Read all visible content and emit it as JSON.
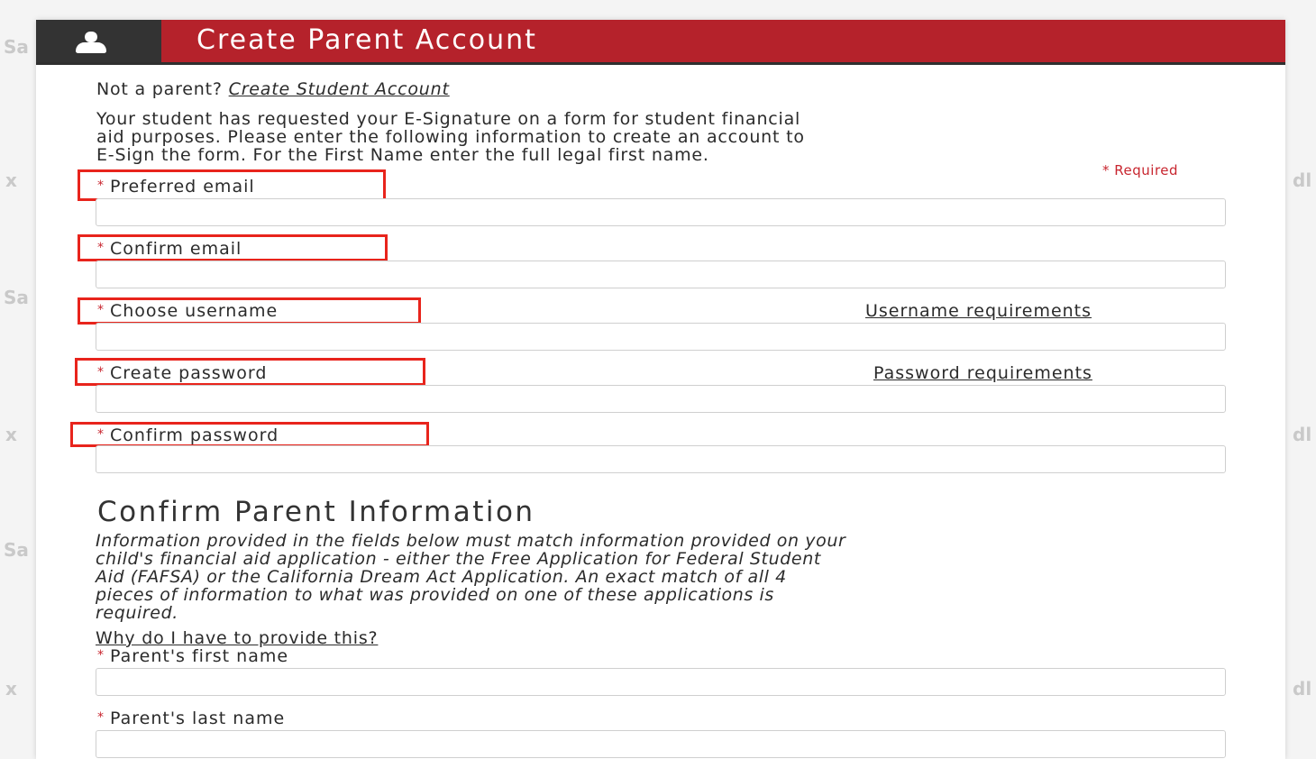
{
  "header": {
    "title": "Create Parent Account",
    "icon": "user-icon"
  },
  "not_parent": {
    "prefix": "Not a parent?",
    "link": "Create Student Account"
  },
  "intro": {
    "line1": "Your student has requested your E-Signature on a form for student financial",
    "line2": "aid purposes.  Please enter the following information to create an account to",
    "line3": "E-Sign the form.  For the First Name enter the full legal first name."
  },
  "required_note": "* Required",
  "required_marker": "*",
  "fields": {
    "preferred_email": {
      "label": "Preferred email",
      "value": ""
    },
    "confirm_email": {
      "label": "Confirm email",
      "value": ""
    },
    "username": {
      "label": "Choose username",
      "value": "",
      "help_link": "Username requirements"
    },
    "password": {
      "label": "Create password",
      "value": "",
      "help_link": "Password requirements"
    },
    "confirm_password": {
      "label": "Confirm password",
      "value": ""
    }
  },
  "parent_section": {
    "title": "Confirm Parent Information",
    "info_line1": "Information provided in the fields below must match information provided on your",
    "info_line2": "child's financial aid application - either the Free Application for Federal Student",
    "info_line3": "Aid (FAFSA) or the California Dream Act Application. An exact match of all 4",
    "info_line4": "pieces of information to what was provided on one of these applications is",
    "info_line5": "required.",
    "why_link": "Why do I have to provide this?",
    "first_name": {
      "label": "Parent's first name",
      "value": ""
    },
    "last_name": {
      "label": "Parent's last name",
      "value": ""
    }
  },
  "colors": {
    "header_red": "#b5222b",
    "header_dark": "#333333",
    "required_red": "#c8262f",
    "highlight_red": "#e8241c"
  }
}
